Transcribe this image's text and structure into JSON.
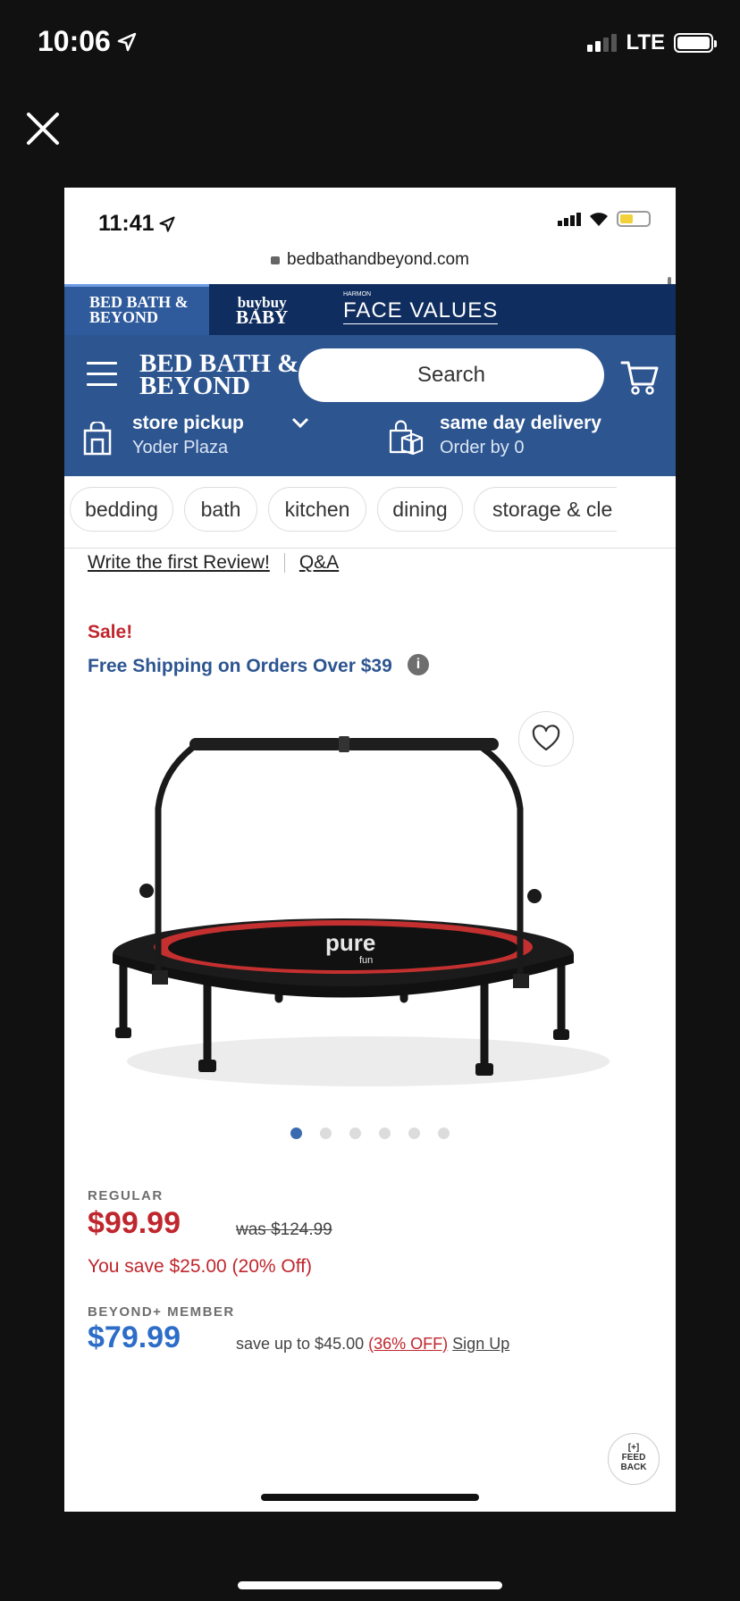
{
  "outer_status": {
    "time": "10:06",
    "network": "LTE"
  },
  "inner_status": {
    "time": "11:41"
  },
  "browser": {
    "url": "bedbathandbeyond.com"
  },
  "brand_tabs": {
    "bbb_line1": "BED BATH &",
    "bbb_line2": "BEYOND",
    "buybuy_line1": "buybuy",
    "buybuy_line2": "BABY",
    "harmon": "HARMON",
    "face_values": "FACE VALUES"
  },
  "header": {
    "logo_line1": "BED BATH &",
    "logo_line2": "BEYOND",
    "search_placeholder": "Search",
    "pickup_title": "store pickup",
    "pickup_store": "Yoder Plaza",
    "delivery_title": "same day delivery",
    "delivery_sub": "Order by 0"
  },
  "categories": [
    "bedding",
    "bath",
    "kitchen",
    "dining",
    "storage & cle"
  ],
  "reviews": {
    "write": "Write the first Review!",
    "qa": "Q&A"
  },
  "promo": {
    "sale": "Sale!",
    "free_shipping": "Free Shipping on Orders Over $39",
    "info": "i"
  },
  "product": {
    "brand_mark": "pure",
    "brand_sub": "fun",
    "image_count": 6,
    "active_image": 1
  },
  "pricing": {
    "regular_label": "REGULAR",
    "price": "$99.99",
    "was": "was $124.99",
    "save": "You save $25.00 (20% Off)",
    "member_label": "BEYOND+ MEMBER",
    "member_price": "$79.99",
    "member_save_prefix": "save up to $45.00",
    "member_save_pct": "(36% OFF)",
    "member_signup": "Sign Up"
  },
  "feedback": {
    "line1": "[+]",
    "line2": "FEED",
    "line3": "BACK"
  },
  "colors": {
    "navy": "#0f2d5e",
    "header_blue": "#2d5590",
    "sale_red": "#c0262d",
    "member_blue": "#2d6cc7"
  }
}
